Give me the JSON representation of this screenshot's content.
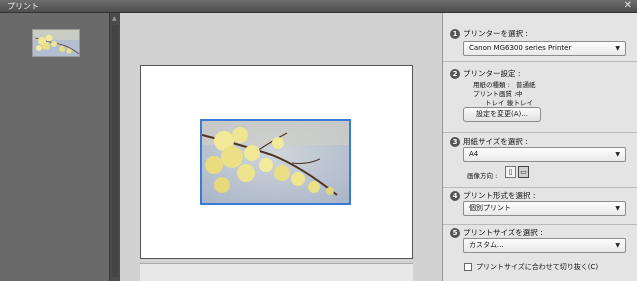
{
  "window": {
    "title": "プリント",
    "close_glyph": "✕"
  },
  "thumbnails": {
    "up_glyph": "▲"
  },
  "settings": {
    "step1": {
      "number": "1",
      "label": "プリンターを選択 :",
      "selected": "Canon MG6300 series Printer"
    },
    "step2": {
      "number": "2",
      "label": "プリンター設定 :",
      "paper_type_label": "用紙の種類 :",
      "paper_type_value": "普通紙",
      "quality_label": "プリント画質 :",
      "quality_value": "中",
      "tray_label": "トレイ :",
      "tray_value": "後トレイ",
      "change_button": "設定を変更(A)..."
    },
    "step3": {
      "number": "3",
      "label": "用紙サイズを選択 :",
      "selected": "A4",
      "orientation_label": "画像方向 :"
    },
    "step4": {
      "number": "4",
      "label": "プリント形式を選択 :",
      "selected": "個別プリント"
    },
    "step5": {
      "number": "5",
      "label": "プリントサイズを選択 :",
      "selected": "カスタム...",
      "crop_checkbox_label": "プリントサイズに合わせて切り抜く(C)"
    }
  },
  "colors": {
    "accent": "#3a7bd5",
    "panel_bg": "#e4e4e4",
    "preview_bg": "#d2d2d2"
  }
}
